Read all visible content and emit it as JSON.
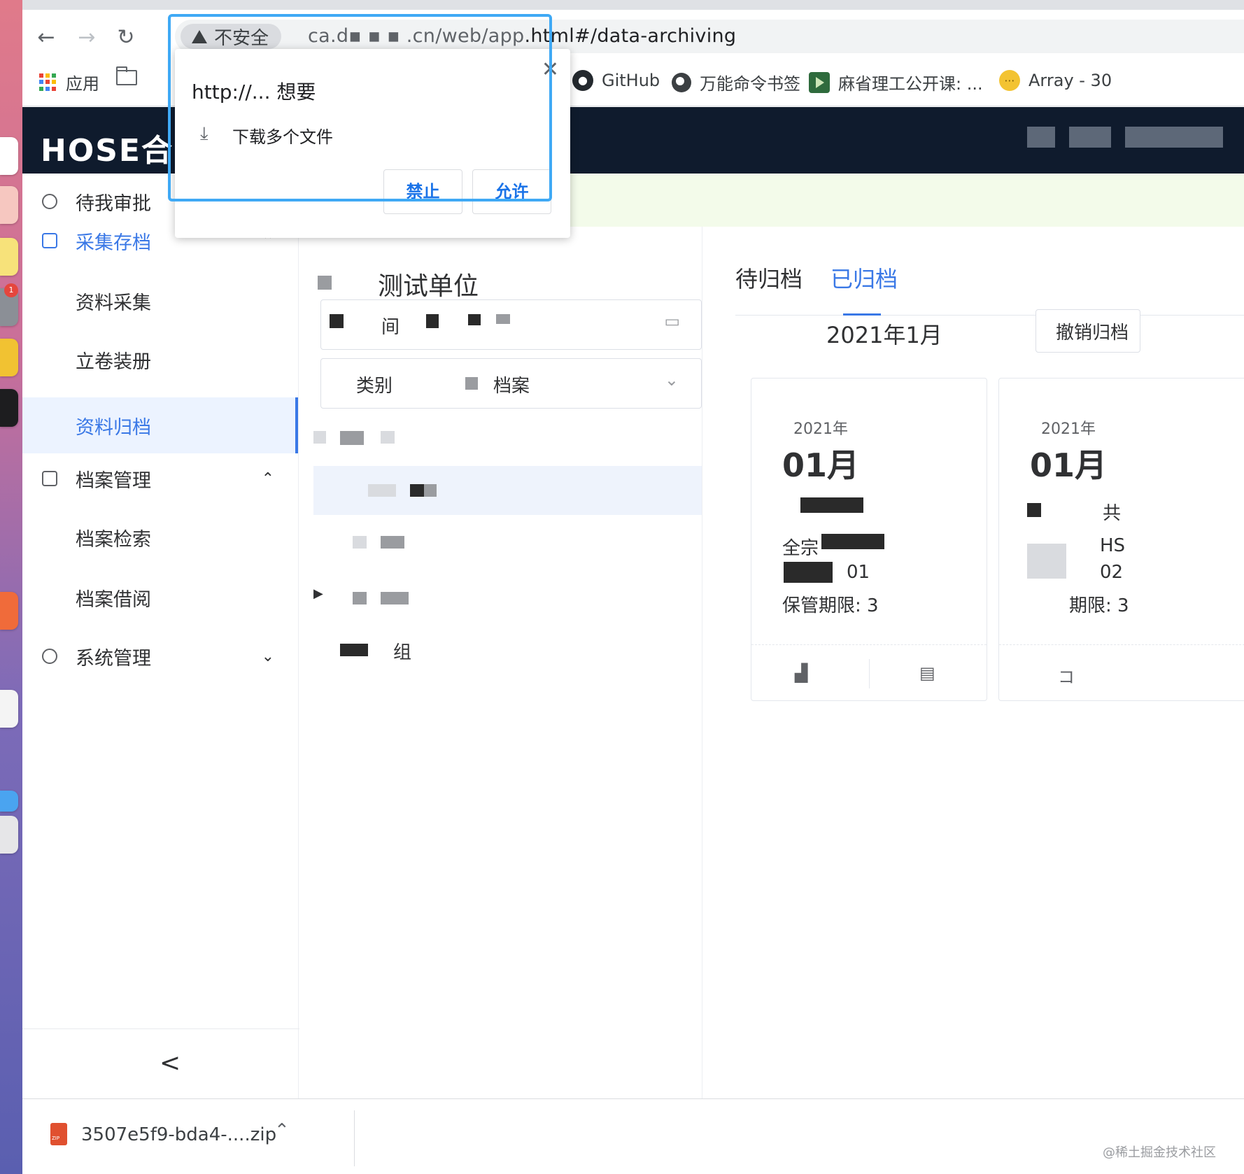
{
  "browser": {
    "security_label": "不安全",
    "url_visible_tail": ".html#/data-archiving",
    "bookmarks": [
      {
        "label": "应用",
        "icon": "apps-grid-icon"
      },
      {
        "label": "GitHub",
        "icon": "github-icon"
      },
      {
        "label": "万能命令书签",
        "icon": "globe-icon"
      },
      {
        "label": "麻省理工公开课: ...",
        "icon": "video-play-icon"
      },
      {
        "label": "Array - 30",
        "icon": "array-icon"
      }
    ]
  },
  "permission_popup": {
    "title": "http://... 想要",
    "message": "下载多个文件",
    "block_label": "禁止",
    "allow_label": "允许"
  },
  "app": {
    "logo": "HOSE合",
    "sidebar": {
      "items": [
        {
          "label": "待我审批",
          "icon": "user-approval-icon"
        },
        {
          "label": "采集存档",
          "icon": "archive-collect-icon",
          "expanded": true
        },
        {
          "label": "资料采集"
        },
        {
          "label": "立卷装册"
        },
        {
          "label": "资料归档",
          "selected": true
        },
        {
          "label": "档案管理",
          "icon": "archive-manage-icon"
        },
        {
          "label": "档案检索"
        },
        {
          "label": "档案借阅"
        },
        {
          "label": "系统管理",
          "icon": "settings-icon"
        }
      ],
      "collapse_glyph": "<"
    },
    "middle": {
      "title": "测试单位",
      "time_field_label": "间",
      "category_field_label": "类别",
      "category_value": "档案",
      "tree_last_label": "组"
    },
    "right": {
      "tabs": [
        {
          "label": "待归档"
        },
        {
          "label": "已归档",
          "active": true
        }
      ],
      "record_period": "2021年1月",
      "revoke_button": "撤销归档",
      "cards": [
        {
          "year": "2021年",
          "month": "01月",
          "line1": "全宗",
          "line2": "01",
          "line3": "保管期限: 3"
        },
        {
          "year": "2021年",
          "month": "01月",
          "line1": "共",
          "line2": "HS",
          "line3": "02",
          "line4": "期限: 3"
        }
      ]
    }
  },
  "download_shelf": {
    "file_name": "3507e5f9-bda4-....zip",
    "watermark": "@稀土掘金技术社区"
  }
}
